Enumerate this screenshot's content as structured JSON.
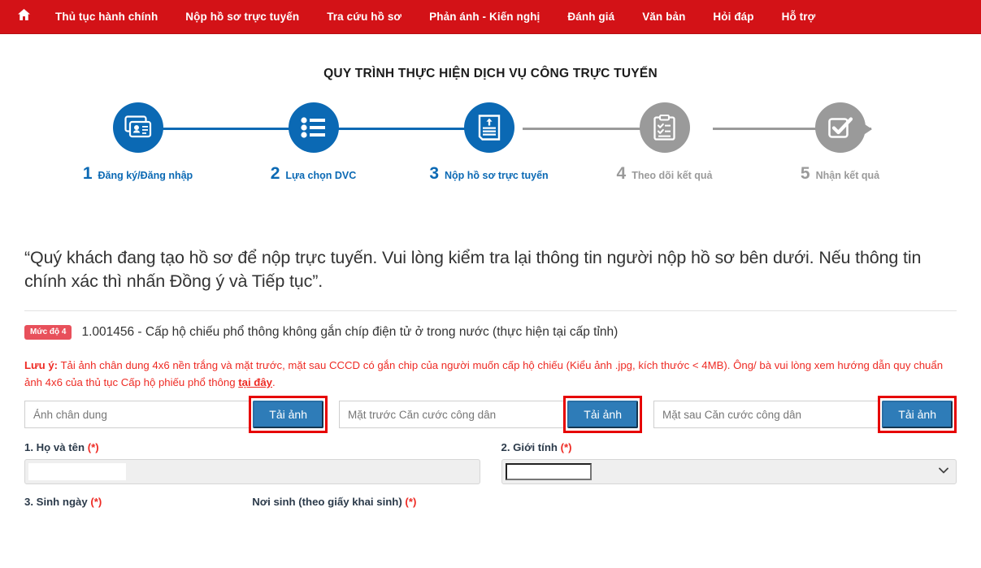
{
  "nav": {
    "home_icon": "home-icon",
    "items": [
      {
        "label": "Thủ tục hành chính"
      },
      {
        "label": "Nộp hồ sơ trực tuyến"
      },
      {
        "label": "Tra cứu hồ sơ"
      },
      {
        "label": "Phản ánh - Kiến nghị"
      },
      {
        "label": "Đánh giá"
      },
      {
        "label": "Văn bản"
      },
      {
        "label": "Hỏi đáp"
      },
      {
        "label": "Hỗ trợ"
      }
    ]
  },
  "process": {
    "title": "QUY TRÌNH THỰC HIỆN DỊCH VỤ CÔNG TRỰC TUYẾN",
    "steps": [
      {
        "number": "1",
        "label": "Đăng ký/Đăng nhập",
        "icon": "id-card-icon",
        "active": true
      },
      {
        "number": "2",
        "label": "Lựa chọn DVC",
        "icon": "list-icon",
        "active": true
      },
      {
        "number": "3",
        "label": "Nộp hồ sơ trực tuyến",
        "icon": "upload-document-icon",
        "active": true
      },
      {
        "number": "4",
        "label": "Theo dõi kết quả",
        "icon": "clipboard-check-icon",
        "active": false
      },
      {
        "number": "5",
        "label": "Nhận kết quả",
        "icon": "checkbox-check-icon",
        "active": false
      }
    ],
    "active_color": "#0b69b4",
    "inactive_color": "#9a9a9a"
  },
  "quote": {
    "text": "“Quý khách đang tạo hồ sơ để nộp trực tuyến. Vui lòng kiểm tra lại thông tin người nộp hồ sơ bên dưới. Nếu thông tin chính xác thì nhấn Đồng ý và Tiếp tục”."
  },
  "service": {
    "badge": "Mức độ 4",
    "badge_color": "#e8505b",
    "name": "1.001456 - Cấp hộ chiếu phổ thông không gắn chíp điện tử ở trong nước (thực hiện tại cấp tỉnh)"
  },
  "note": {
    "prefix": "Lưu ý:",
    "body": " Tải ảnh chân dung 4x6 nền trắng và mặt trước, mặt sau CCCD có gắn chip của người muốn cấp hộ chiếu (Kiểu ảnh .jpg, kích thước < 4MB). Ông/ bà vui lòng xem hướng dẫn quy chuẩn ảnh 4x6 của thủ tục Cấp hộ phiếu phổ thông ",
    "link": "tại đây",
    "suffix": ".",
    "color": "#ee2b24"
  },
  "uploads": {
    "button_label": "Tải ảnh",
    "button_color": "#2e7cb8",
    "highlight_color": "#e60000",
    "fields": [
      {
        "placeholder": "Ảnh chân dung",
        "value": ""
      },
      {
        "placeholder": "Mặt trước Căn cước công dân",
        "value": ""
      },
      {
        "placeholder": "Mặt sau Căn cước công dân",
        "value": ""
      }
    ]
  },
  "form": {
    "required_mark": "(*)",
    "fields": [
      {
        "label": "1. Họ và tên",
        "required": true,
        "value": "",
        "type": "text"
      },
      {
        "label": "2. Giới tính",
        "required": true,
        "value": "",
        "type": "select"
      },
      {
        "label": "3. Sinh ngày",
        "required": true,
        "value": "",
        "type": "text"
      },
      {
        "label": "Nơi sinh (theo giấy khai sinh)",
        "required": true,
        "value": "",
        "type": "text"
      }
    ]
  }
}
